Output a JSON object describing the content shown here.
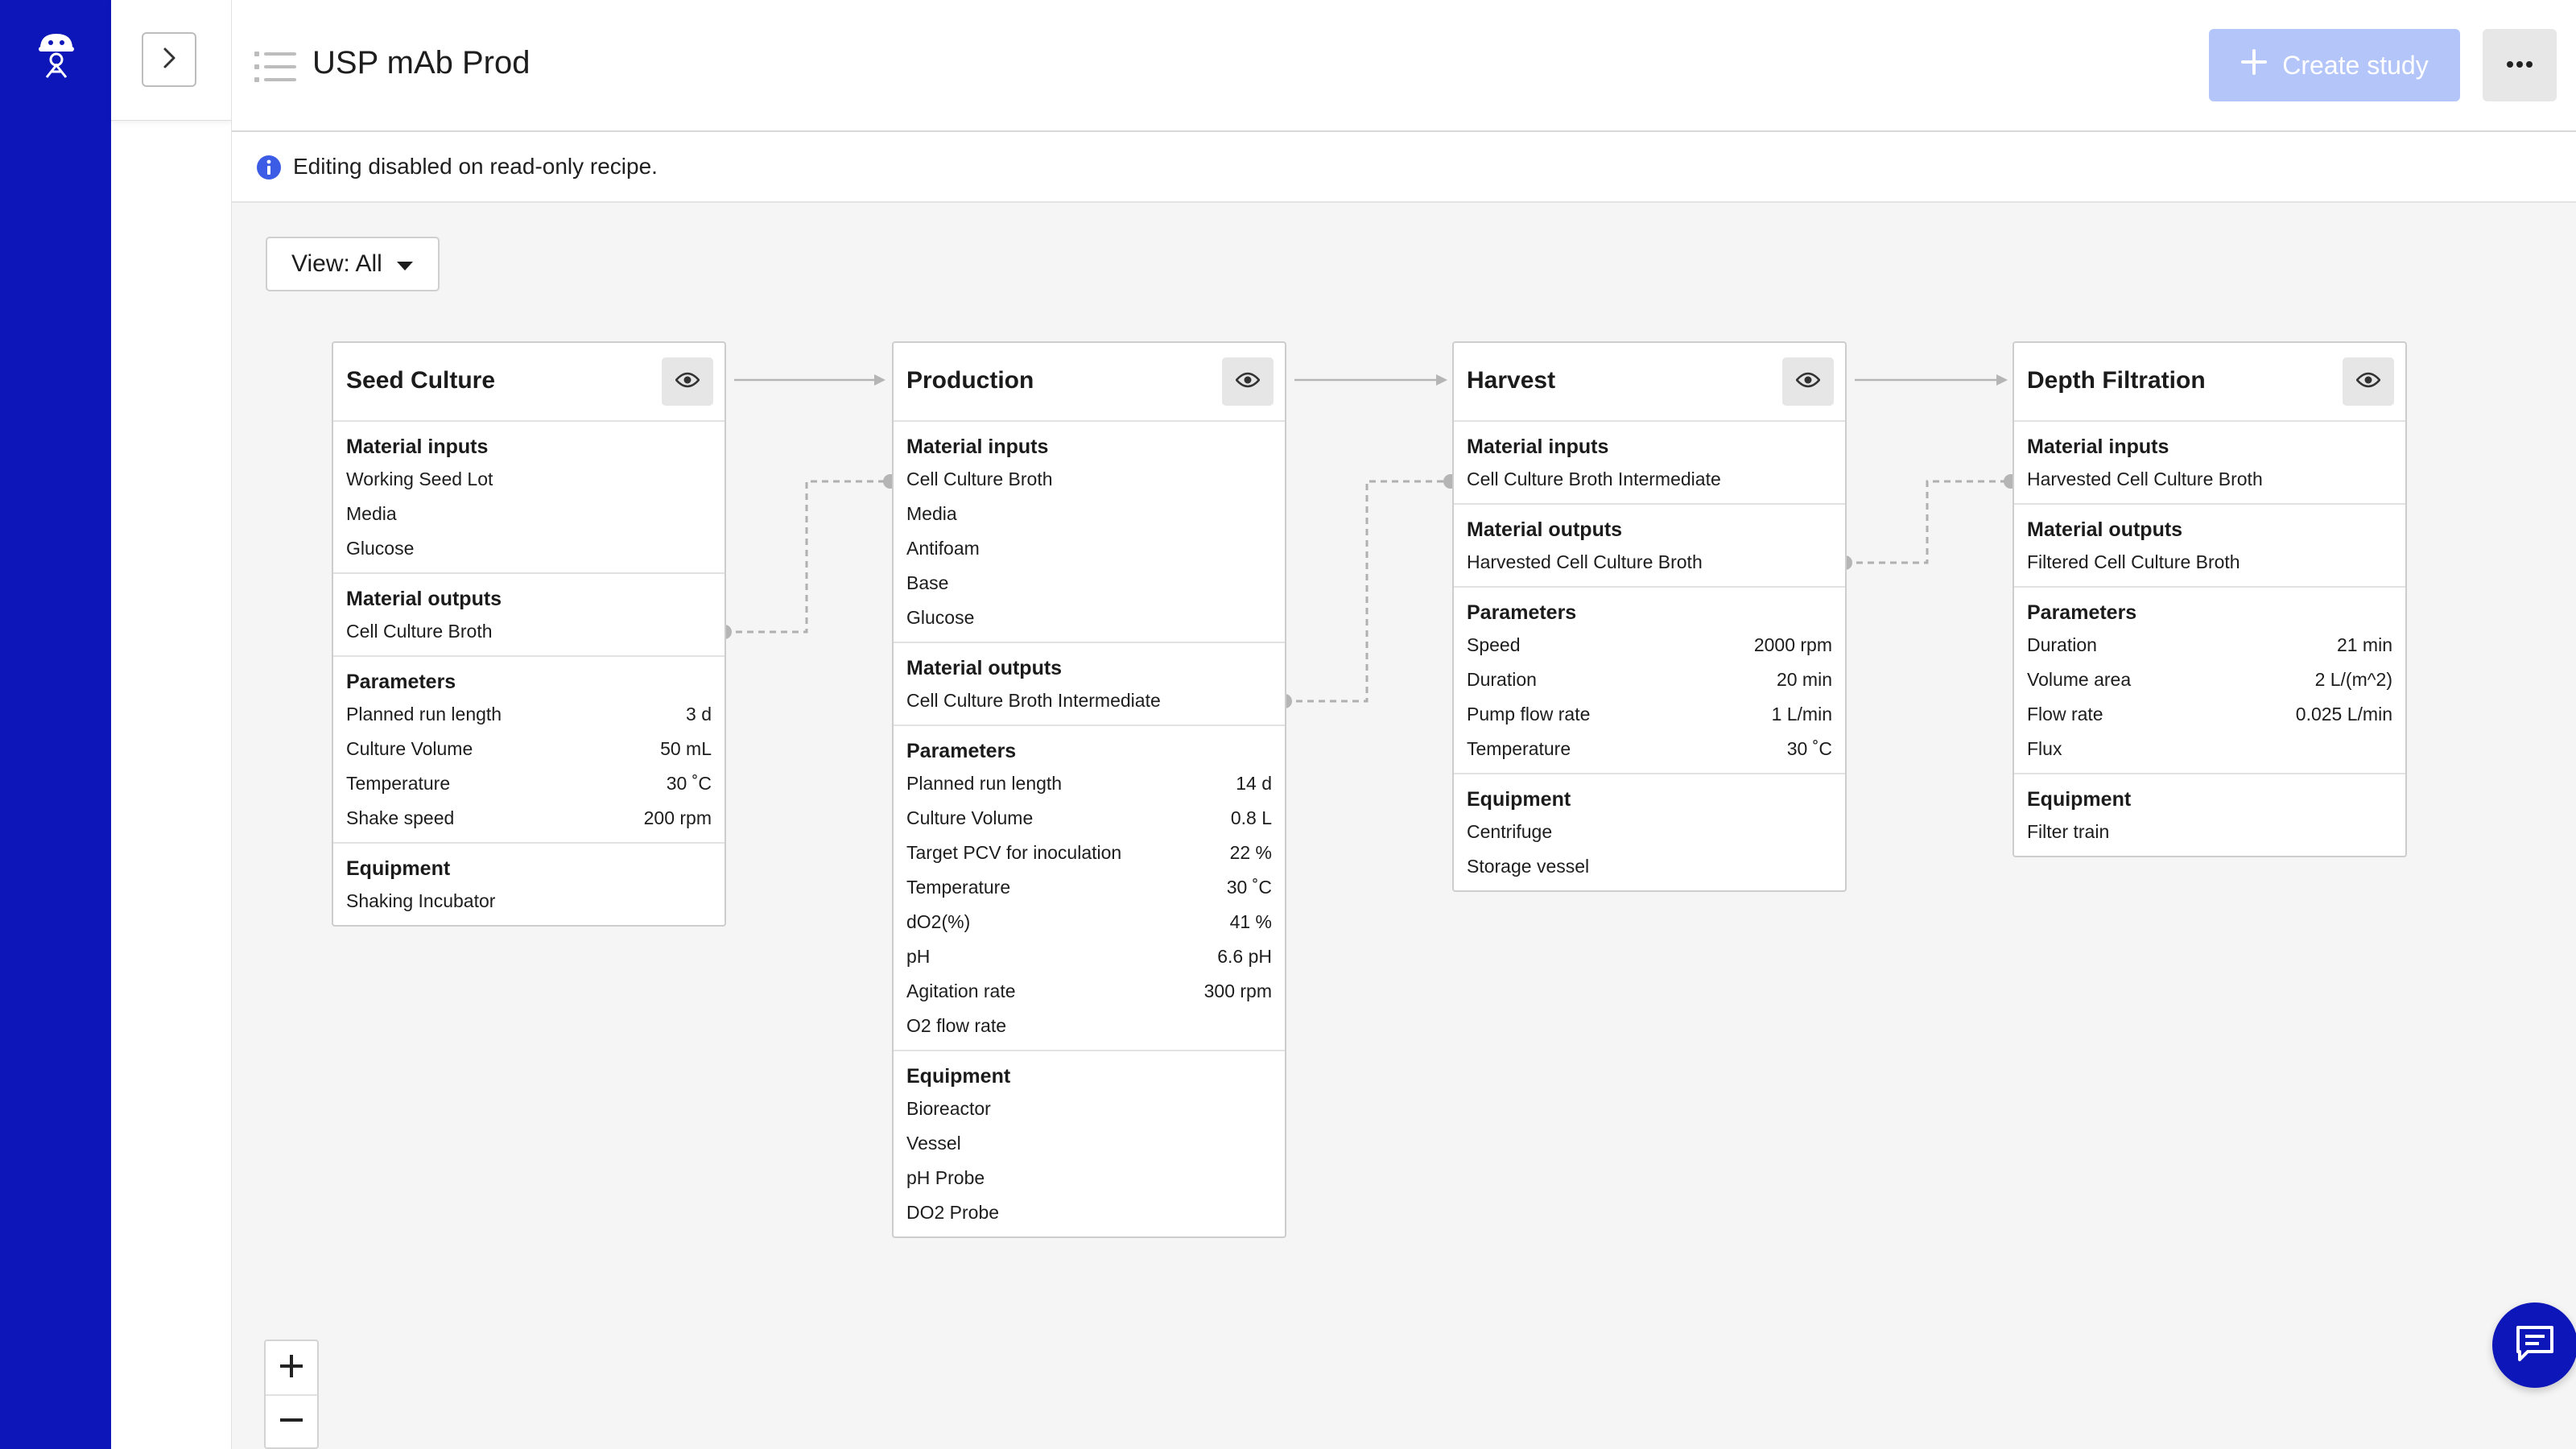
{
  "app": {
    "page_title": "USP mAb Prod",
    "create_button": "Create study",
    "banner_text": "Editing disabled on read-only recipe.",
    "view_label": "View: All",
    "colors": {
      "nav": "#0d16b8",
      "primary_disabled": "#b4c6f9",
      "info": "#3d5ce6"
    }
  },
  "icons": {
    "brand": "robot-logo-icon",
    "expand": "chevron-right-icon",
    "list": "list-icon",
    "plus": "plus-icon",
    "more": "more-horizontal-icon",
    "info": "info-icon",
    "eye": "eye-icon",
    "chat": "chat-icon"
  },
  "cards": [
    {
      "title": "Seed Culture",
      "sections": [
        {
          "title": "Material inputs",
          "rows": [
            {
              "label": "Working Seed Lot",
              "value": ""
            },
            {
              "label": "Media",
              "value": ""
            },
            {
              "label": "Glucose",
              "value": ""
            }
          ]
        },
        {
          "title": "Material outputs",
          "rows": [
            {
              "label": "Cell Culture Broth",
              "value": ""
            }
          ]
        },
        {
          "title": "Parameters",
          "rows": [
            {
              "label": "Planned run length",
              "value": "3 d"
            },
            {
              "label": "Culture Volume",
              "value": "50 mL"
            },
            {
              "label": "Temperature",
              "value": "30 ˚C"
            },
            {
              "label": "Shake speed",
              "value": "200 rpm"
            }
          ]
        },
        {
          "title": "Equipment",
          "rows": [
            {
              "label": "Shaking Incubator",
              "value": ""
            }
          ]
        }
      ]
    },
    {
      "title": "Production",
      "sections": [
        {
          "title": "Material inputs",
          "rows": [
            {
              "label": "Cell Culture Broth",
              "value": ""
            },
            {
              "label": "Media",
              "value": ""
            },
            {
              "label": "Antifoam",
              "value": ""
            },
            {
              "label": "Base",
              "value": ""
            },
            {
              "label": "Glucose",
              "value": ""
            }
          ]
        },
        {
          "title": "Material outputs",
          "rows": [
            {
              "label": "Cell Culture Broth Intermediate",
              "value": ""
            }
          ]
        },
        {
          "title": "Parameters",
          "rows": [
            {
              "label": "Planned run length",
              "value": "14 d"
            },
            {
              "label": "Culture Volume",
              "value": "0.8 L"
            },
            {
              "label": "Target PCV for inoculation",
              "value": "22 %"
            },
            {
              "label": "Temperature",
              "value": "30 ˚C"
            },
            {
              "label": "dO2(%)",
              "value": "41 %"
            },
            {
              "label": "pH",
              "value": "6.6 pH"
            },
            {
              "label": "Agitation rate",
              "value": "300 rpm"
            },
            {
              "label": "O2 flow rate",
              "value": ""
            }
          ]
        },
        {
          "title": "Equipment",
          "rows": [
            {
              "label": "Bioreactor",
              "value": ""
            },
            {
              "label": "Vessel",
              "value": ""
            },
            {
              "label": "pH Probe",
              "value": ""
            },
            {
              "label": "DO2 Probe",
              "value": ""
            }
          ]
        }
      ]
    },
    {
      "title": "Harvest",
      "sections": [
        {
          "title": "Material inputs",
          "rows": [
            {
              "label": "Cell Culture Broth Intermediate",
              "value": ""
            }
          ]
        },
        {
          "title": "Material outputs",
          "rows": [
            {
              "label": "Harvested Cell Culture Broth",
              "value": ""
            }
          ]
        },
        {
          "title": "Parameters",
          "rows": [
            {
              "label": "Speed",
              "value": "2000 rpm"
            },
            {
              "label": "Duration",
              "value": "20 min"
            },
            {
              "label": "Pump flow rate",
              "value": "1 L/min"
            },
            {
              "label": "Temperature",
              "value": "30 ˚C"
            }
          ]
        },
        {
          "title": "Equipment",
          "rows": [
            {
              "label": "Centrifuge",
              "value": ""
            },
            {
              "label": "Storage vessel",
              "value": ""
            }
          ]
        }
      ]
    },
    {
      "title": "Depth Filtration",
      "sections": [
        {
          "title": "Material inputs",
          "rows": [
            {
              "label": "Harvested Cell Culture Broth",
              "value": ""
            }
          ]
        },
        {
          "title": "Material outputs",
          "rows": [
            {
              "label": "Filtered Cell Culture Broth",
              "value": ""
            }
          ]
        },
        {
          "title": "Parameters",
          "rows": [
            {
              "label": "Duration",
              "value": "21 min"
            },
            {
              "label": "Volume area",
              "value": "2 L/(m^2)"
            },
            {
              "label": "Flow rate",
              "value": "0.025 L/min"
            },
            {
              "label": "Flux",
              "value": ""
            }
          ]
        },
        {
          "title": "Equipment",
          "rows": [
            {
              "label": "Filter train",
              "value": ""
            }
          ]
        }
      ]
    }
  ]
}
